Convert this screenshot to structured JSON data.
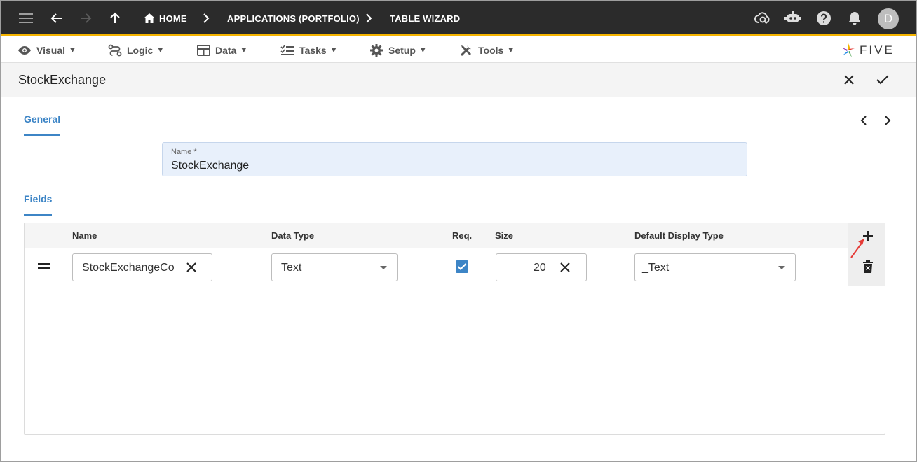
{
  "breadcrumbs": [
    "HOME",
    "APPLICATIONS (PORTFOLIO)",
    "TABLE WIZARD"
  ],
  "user": {
    "initial": "D"
  },
  "menu": [
    {
      "label": "Visual",
      "icon": "eye-icon"
    },
    {
      "label": "Logic",
      "icon": "flow-icon"
    },
    {
      "label": "Data",
      "icon": "table-icon"
    },
    {
      "label": "Tasks",
      "icon": "checklist-icon"
    },
    {
      "label": "Setup",
      "icon": "gear-icon"
    },
    {
      "label": "Tools",
      "icon": "tools-icon"
    }
  ],
  "menu_caret": "▼",
  "brand": {
    "name": "FIVE"
  },
  "title": "StockExchange",
  "tabs": {
    "general": "General",
    "fields": "Fields"
  },
  "name_field": {
    "label": "Name *",
    "value": "StockExchange"
  },
  "table": {
    "headers": {
      "name": "Name",
      "data_type": "Data Type",
      "req": "Req.",
      "size": "Size",
      "display_type": "Default Display Type"
    },
    "rows": [
      {
        "name": "StockExchangeCo",
        "data_type": "Text",
        "required": true,
        "size": "20",
        "display_type": "_Text"
      }
    ]
  },
  "colors": {
    "appbar": "#2b2b2b",
    "accent_bar": "#f5b400",
    "primary": "#3d85c6",
    "annotation_arrow": "#e53935"
  }
}
